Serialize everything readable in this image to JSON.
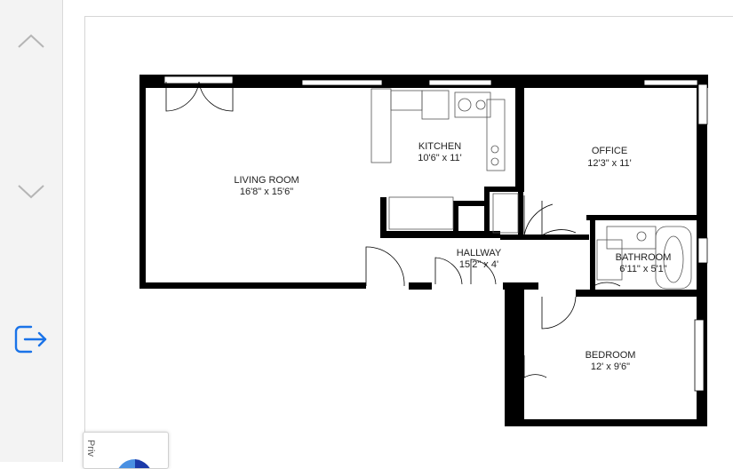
{
  "sidebar": {
    "up_icon": "chevron-up-icon",
    "down_icon": "chevron-down-icon",
    "exit_icon": "exit-icon",
    "accent_color": "#1a73e8"
  },
  "floorplan": {
    "rooms": {
      "living": {
        "name": "LIVING ROOM",
        "dims": "16'8\" x 15'6\""
      },
      "kitchen": {
        "name": "KITCHEN",
        "dims": "10'6\" x 11'"
      },
      "office": {
        "name": "OFFICE",
        "dims": "12'3\" x 11'"
      },
      "hallway": {
        "name": "HALLWAY",
        "dims": "15'2\" x 4'"
      },
      "bathroom": {
        "name": "BATHROOM",
        "dims": "6'11\" x 5'1\""
      },
      "bedroom": {
        "name": "BEDROOM",
        "dims": "12' x 9'6\""
      }
    }
  },
  "privacy_badge": {
    "label": "Priv"
  }
}
